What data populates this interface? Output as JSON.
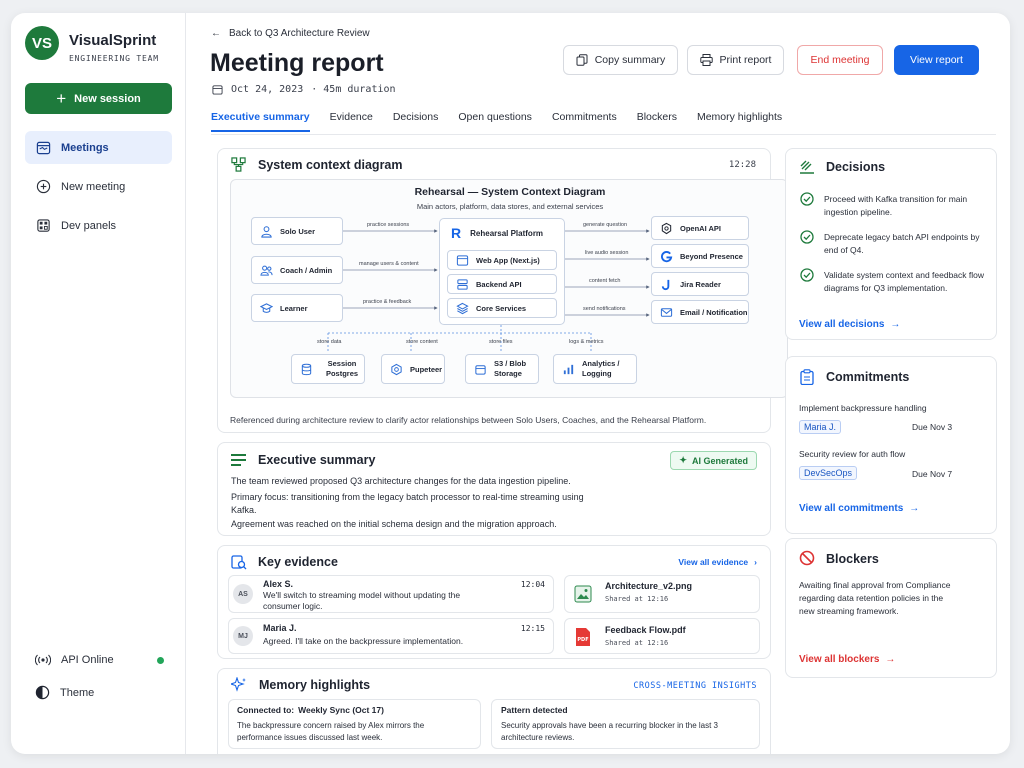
{
  "brand": {
    "initials": "VS",
    "name": "VisualSprint",
    "subtitle": "ENGINEERING TEAM"
  },
  "sidebar": {
    "new_session_label": "New session",
    "items": [
      {
        "label": "Meetings",
        "icon": "calendar-icon",
        "active": true
      },
      {
        "label": "New meeting",
        "icon": "plus-circle-icon",
        "active": false
      },
      {
        "label": "Dev panels",
        "icon": "panels-icon",
        "active": false
      }
    ],
    "api_status": "API Online",
    "theme_label": "Theme",
    "status_color": "#22a559"
  },
  "header": {
    "back_label": "Back to Q3 Architecture Review",
    "title": "Meeting report",
    "date": "Oct 24, 2023",
    "duration": "· 45m duration",
    "buttons": {
      "copy": "Copy summary",
      "print": "Print report",
      "end": "End meeting",
      "view": "View report"
    }
  },
  "tabs": [
    "Executive summary",
    "Evidence",
    "Decisions",
    "Open questions",
    "Commitments",
    "Blockers",
    "Memory highlights"
  ],
  "diagram_card": {
    "title": "System context diagram",
    "time": "12:28",
    "diagram_title": "Rehearsal — System Context Diagram",
    "diagram_subtitle": "Main actors, platform, data stores, and external services",
    "actors": [
      "Solo User",
      "Coach / Admin",
      "Learner"
    ],
    "platform": {
      "title": "Rehearsal Platform",
      "modules": [
        "Web App (Next.js)",
        "Backend API",
        "Core Services"
      ]
    },
    "externals": [
      "OpenAI API",
      "Beyond Presence",
      "Jira Reader",
      "Email / Notification"
    ],
    "stores": [
      {
        "label": "Session Postgres"
      },
      {
        "label": "Pupeteer"
      },
      {
        "label": "S3 / Blob Storage"
      },
      {
        "label": "Analytics / Logging"
      }
    ],
    "edges_left": [
      "practice sessions",
      "manage users & content",
      "practice & feedback"
    ],
    "edges_right": [
      "generate question",
      "live audio session",
      "content fetch",
      "send notifications"
    ],
    "edges_bottom": [
      "store data",
      "store content",
      "store files",
      "logs & metrics"
    ],
    "caption": "Referenced during architecture review to clarify actor relationships between Solo Users, Coaches, and the Rehearsal Platform."
  },
  "summary_card": {
    "title": "Executive summary",
    "badge": "AI Generated",
    "paragraphs": [
      "The team reviewed proposed Q3 architecture changes for the data ingestion pipeline.",
      "Primary focus: transitioning from the legacy batch processor to real-time streaming using Kafka.",
      "Agreement was reached on the initial schema design and the migration approach."
    ]
  },
  "evidence_card": {
    "title": "Key evidence",
    "view_all": "View all evidence",
    "quotes": [
      {
        "initials": "AS",
        "name": "Alex S.",
        "time": "12:04",
        "text": "We'll switch to streaming model without updating the consumer logic."
      },
      {
        "initials": "MJ",
        "name": "Maria J.",
        "time": "12:15",
        "text": "Agreed. I'll take on the backpressure implementation."
      }
    ],
    "files": [
      {
        "name": "Architecture_v2.png",
        "shared": "Shared at 12:16",
        "icon": "image-file-icon"
      },
      {
        "name": "Feedback Flow.pdf",
        "shared": "Shared at 12:16",
        "icon": "pdf-file-icon"
      }
    ]
  },
  "memory_card": {
    "title": "Memory highlights",
    "tag": "CROSS-MEETING INSIGHTS",
    "items": [
      {
        "prefix": "Connected to:",
        "title": "Weekly Sync (Oct 17)",
        "text": "The backpressure concern raised by Alex mirrors the performance issues discussed last week."
      },
      {
        "prefix": "",
        "title": "Pattern detected",
        "text": "Security approvals have been a recurring blocker in the last 3 architecture reviews."
      }
    ]
  },
  "decisions_card": {
    "title": "Decisions",
    "items": [
      "Proceed with Kafka transition for main ingestion pipeline.",
      "Deprecate legacy batch API endpoints by end of Q4.",
      "Validate system context and feedback flow diagrams for Q3 implementation."
    ],
    "view_all": "View all decisions"
  },
  "commitments_card": {
    "title": "Commitments",
    "items": [
      {
        "task": "Implement backpressure handling",
        "owner": "Maria J.",
        "due": "Due Nov 3"
      },
      {
        "task": "Security review for auth flow",
        "owner": "DevSecOps",
        "due": "Due Nov 7"
      }
    ],
    "view_all": "View all commitments"
  },
  "blockers_card": {
    "title": "Blockers",
    "text": "Awaiting final approval from Compliance regarding data retention policies in the new streaming framework.",
    "view_all": "View all blockers"
  },
  "colors": {
    "brand_green": "#1e7a3c",
    "primary_blue": "#1765e6",
    "danger_red": "#dd3333"
  }
}
